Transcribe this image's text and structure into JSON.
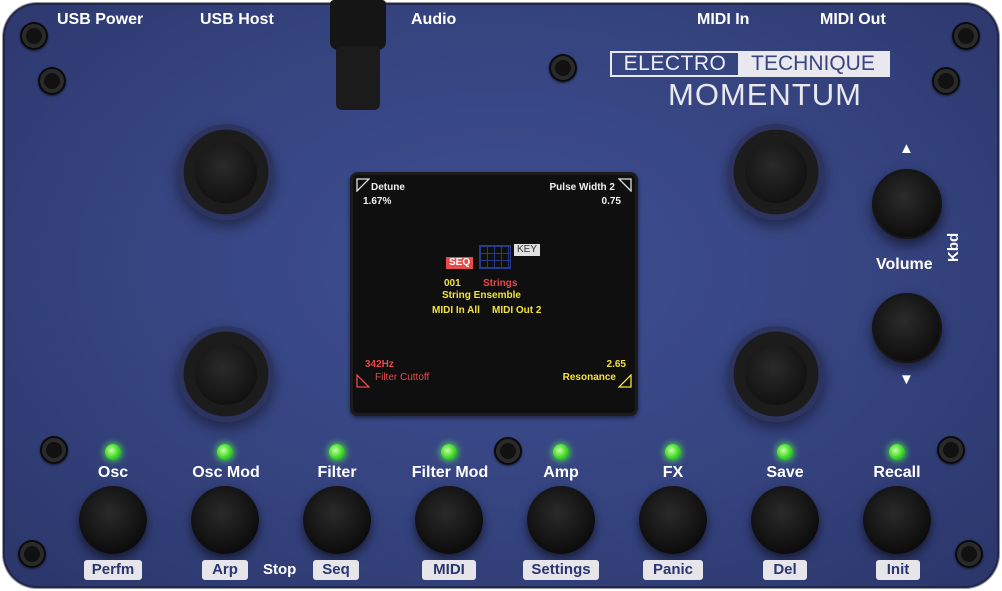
{
  "top_labels": {
    "usb_power": "USB Power",
    "usb_host": "USB Host",
    "audio": "Audio",
    "midi_in": "MIDI In",
    "midi_out": "MIDI Out"
  },
  "logo": {
    "electro": "ELECTRO",
    "technique": "TECHNIQUE",
    "momentum": "MOMENTUM"
  },
  "side_controls": {
    "volume_label": "Volume",
    "kbd_label": "Kbd",
    "up_arrow": "▲",
    "down_arrow": "▼"
  },
  "screen": {
    "top_left": {
      "name": "Detune",
      "value": "1.67%"
    },
    "top_right": {
      "name": "Pulse Width 2",
      "value": "0.75"
    },
    "bottom_left": {
      "name": "Filter Cuttoff",
      "value": "342Hz"
    },
    "bottom_right": {
      "name": "Resonance",
      "value": "2.65"
    },
    "seq_tag": "SEQ",
    "key_tag": "KEY",
    "patch_number": "001",
    "patch_category": "Strings",
    "patch_name": "String Ensemble",
    "midi_in": "MIDI In All",
    "midi_out": "MIDI Out 2"
  },
  "buttons": [
    {
      "label": "Osc",
      "secondary": "Perfm"
    },
    {
      "label": "Osc Mod",
      "secondary": "Arp"
    },
    {
      "label": "Filter",
      "secondary": "Seq"
    },
    {
      "label": "Filter Mod",
      "secondary": "MIDI"
    },
    {
      "label": "Amp",
      "secondary": "Settings"
    },
    {
      "label": "FX",
      "secondary": "Panic"
    },
    {
      "label": "Save",
      "secondary": "Del"
    },
    {
      "label": "Recall",
      "secondary": "Init"
    }
  ],
  "stop_label": "Stop",
  "colors": {
    "panel": "#35437f",
    "led": "#38d62a",
    "screen_yellow": "#f4e23a",
    "screen_red": "#e84a4a"
  }
}
